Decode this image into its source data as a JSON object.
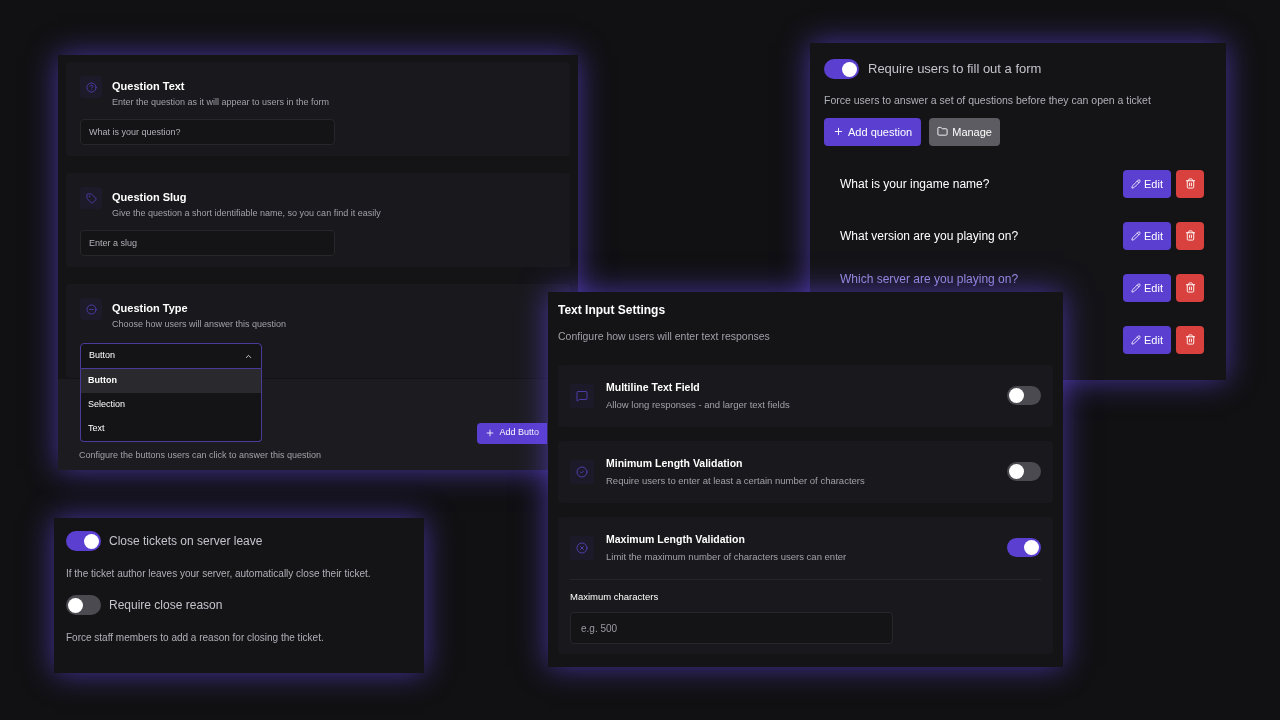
{
  "question_editor": {
    "sections": [
      {
        "kind": "input",
        "title": "Question Text",
        "description": "Enter the question as it will appear to users in the form",
        "placeholder": "What is your question?"
      },
      {
        "kind": "input",
        "title": "Question Slug",
        "description": "Give the question a short identifiable name, so you can find it easily",
        "placeholder": "Enter a slug"
      },
      {
        "kind": "select",
        "title": "Question Type",
        "description": "Choose how users will answer this question",
        "value": "Button",
        "options": [
          {
            "label": "Button",
            "selected": true
          },
          {
            "label": "Selection",
            "selected": false
          },
          {
            "label": "Text",
            "selected": false
          }
        ]
      }
    ],
    "add_button": "Add Butto",
    "caption": "Configure the buttons users can click to answer this question"
  },
  "form_settings": {
    "toggle": {
      "label": "Require users to fill out a form",
      "on": true
    },
    "description": "Force users to answer a set of questions before they can open a ticket",
    "add_question": "Add question",
    "manage": "Manage",
    "questions": [
      {
        "text": "What is your ingame name?",
        "edit": "Edit"
      },
      {
        "text": "What version are you playing on?",
        "edit": "Edit"
      },
      {
        "text": "Which server are you playing on?",
        "edit": "Edit"
      },
      {
        "edit": "Edit"
      }
    ]
  },
  "text_input_settings": {
    "title": "Text Input Settings",
    "description": "Configure how users will enter text responses",
    "settings": [
      {
        "title": "Multiline Text Field",
        "description": "Allow long responses - and larger text fields",
        "on": false
      },
      {
        "title": "Minimum Length Validation",
        "description": "Require users to enter at least a certain number of characters",
        "on": false
      },
      {
        "title": "Maximum Length Validation",
        "description": "Limit the maximum number of characters users can enter",
        "on": true,
        "field_label": "Maximum characters",
        "placeholder": "e.g. 500"
      }
    ]
  },
  "ticket_close": {
    "settings": [
      {
        "label": "Close tickets on server leave",
        "on": true,
        "description": "If the ticket author leaves your server, automatically close their ticket."
      },
      {
        "label": "Require close reason",
        "on": false,
        "description": "Force staff members to add a reason for closing the ticket."
      }
    ]
  }
}
